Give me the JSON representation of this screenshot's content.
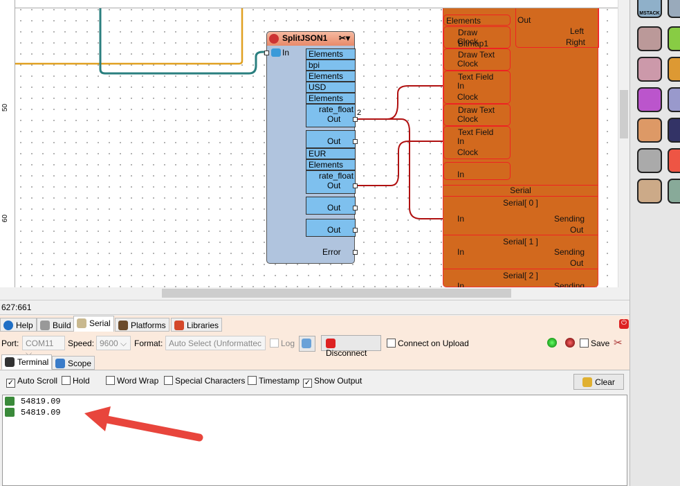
{
  "canvas": {
    "ruler_labels": [
      "50",
      "60"
    ],
    "split_json": {
      "title": "SplitJSON1",
      "in_label": "In",
      "cells": [
        "Elements",
        "bpi",
        "Elements",
        "USD",
        "Elements",
        "rate_float",
        "Out",
        "Out",
        "EUR",
        "Elements",
        "rate_float",
        "Out",
        "Out",
        "Out"
      ],
      "error_label": "Error",
      "wire_label": "2"
    },
    "display": {
      "cells": [
        "Elements",
        "Draw Bitmap1",
        "Clock",
        "Draw Text",
        "Clock",
        "Text Field",
        "In",
        "Clock",
        "Draw Text",
        "Clock",
        "Text Field",
        "In",
        "Clock",
        "In"
      ],
      "buttons": {
        "out": "Out",
        "left": "Left",
        "right": "Right"
      }
    },
    "serial": {
      "header": "Serial",
      "channels": [
        {
          "name": "Serial[ 0 ]",
          "in": "In",
          "sending": "Sending",
          "out": "Out"
        },
        {
          "name": "Serial[ 1 ]",
          "in": "In",
          "sending": "Sending",
          "out": "Out"
        },
        {
          "name": "Serial[ 2 ]",
          "in": "In",
          "sending": "Sending"
        }
      ]
    },
    "wire_colors": {
      "teal": "#2a7f7f",
      "orange": "#e0a020",
      "red": "#b01010"
    }
  },
  "status": {
    "coords": "627:661"
  },
  "panel": {
    "tabs": [
      {
        "label": "Help"
      },
      {
        "label": "Build"
      },
      {
        "label": "Serial",
        "active": true
      },
      {
        "label": "Platforms"
      },
      {
        "label": "Libraries"
      }
    ],
    "toolbar": {
      "port_label": "Port:",
      "port_value": "COM11",
      "speed_label": "Speed:",
      "speed_value": "9600",
      "format_label": "Format:",
      "format_value": "Auto Select (Unformattec",
      "log_label": "Log",
      "disconnect_label": "Disconnect",
      "connect_on_upload_label": "Connect on Upload",
      "save_label": "Save"
    },
    "subtabs": [
      {
        "label": "Terminal",
        "active": true
      },
      {
        "label": "Scope"
      }
    ],
    "options": [
      {
        "label": "Auto Scroll",
        "checked": true
      },
      {
        "label": "Hold",
        "checked": false
      },
      {
        "label": "Word Wrap",
        "checked": false
      },
      {
        "label": "Special Characters",
        "checked": false
      },
      {
        "label": "Timestamp",
        "checked": false
      },
      {
        "label": "Show Output",
        "checked": true
      }
    ],
    "clear_label": "Clear",
    "output_lines": [
      "54819.09",
      "54819.09"
    ]
  },
  "palette": {
    "first_label": "MSTACK"
  },
  "annotation": {
    "arrow_color": "#e8453c"
  }
}
